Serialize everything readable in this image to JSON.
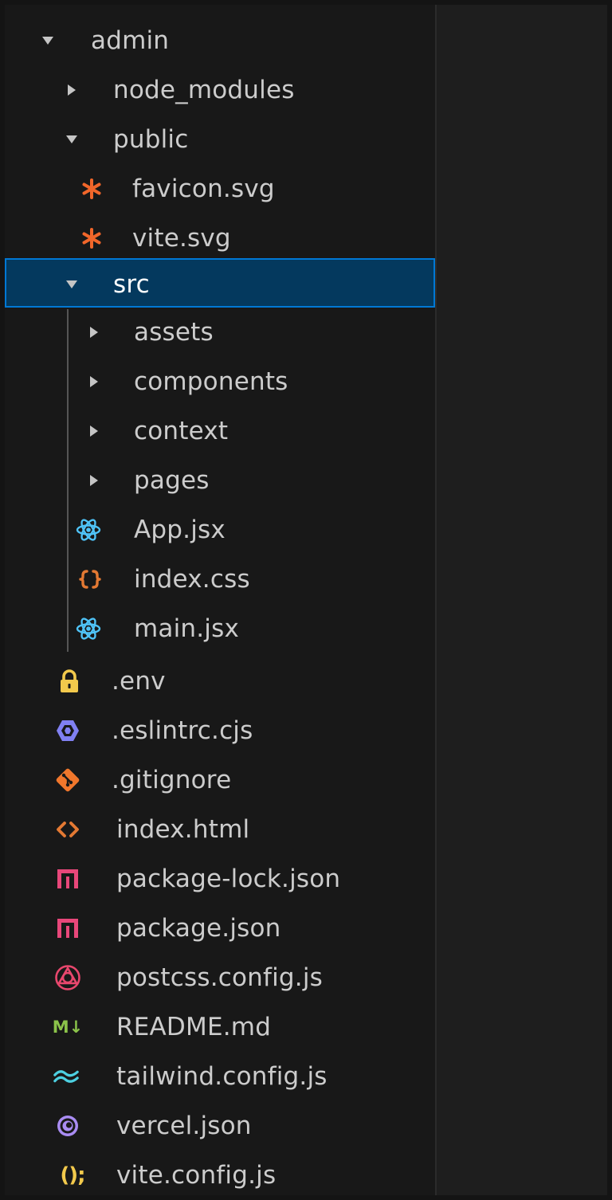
{
  "explorer": {
    "root": {
      "label": "admin"
    },
    "node_modules": {
      "label": "node_modules"
    },
    "public": {
      "label": "public",
      "children": [
        {
          "label": "favicon.svg",
          "icon": "svg-asterisk-icon",
          "color": "#f1662a"
        },
        {
          "label": "vite.svg",
          "icon": "svg-asterisk-icon",
          "color": "#f1662a"
        }
      ]
    },
    "src": {
      "label": "src",
      "folders": [
        {
          "label": "assets"
        },
        {
          "label": "components"
        },
        {
          "label": "context"
        },
        {
          "label": "pages"
        }
      ],
      "files": [
        {
          "label": "App.jsx",
          "icon": "react-icon",
          "color": "#4fc3f7"
        },
        {
          "label": "index.css",
          "icon": "css-braces-icon",
          "color": "#e37933"
        },
        {
          "label": "main.jsx",
          "icon": "react-icon",
          "color": "#4fc3f7"
        }
      ]
    },
    "files": [
      {
        "label": ".env",
        "icon": "lock-icon",
        "color": "#f2c94c"
      },
      {
        "label": ".eslintrc.cjs",
        "icon": "eslint-icon",
        "color": "#8080f2"
      },
      {
        "label": ".gitignore",
        "icon": "git-icon",
        "color": "#f1772c"
      },
      {
        "label": "index.html",
        "icon": "html-icon",
        "color": "#e37933"
      },
      {
        "label": "package-lock.json",
        "icon": "npm-icon",
        "color": "#e8477a"
      },
      {
        "label": "package.json",
        "icon": "npm-icon",
        "color": "#e8477a"
      },
      {
        "label": "postcss.config.js",
        "icon": "postcss-icon",
        "color": "#e8476d"
      },
      {
        "label": "README.md",
        "icon": "markdown-icon",
        "color": "#8bc34a",
        "glyph": "M↓"
      },
      {
        "label": "tailwind.config.js",
        "icon": "tailwind-icon",
        "color": "#4dd0e1"
      },
      {
        "label": "vercel.json",
        "icon": "vercel-icon",
        "color": "#a98cf2"
      },
      {
        "label": "vite.config.js",
        "icon": "js-config-icon",
        "color": "#f2c94c",
        "glyph": "();"
      }
    ]
  }
}
